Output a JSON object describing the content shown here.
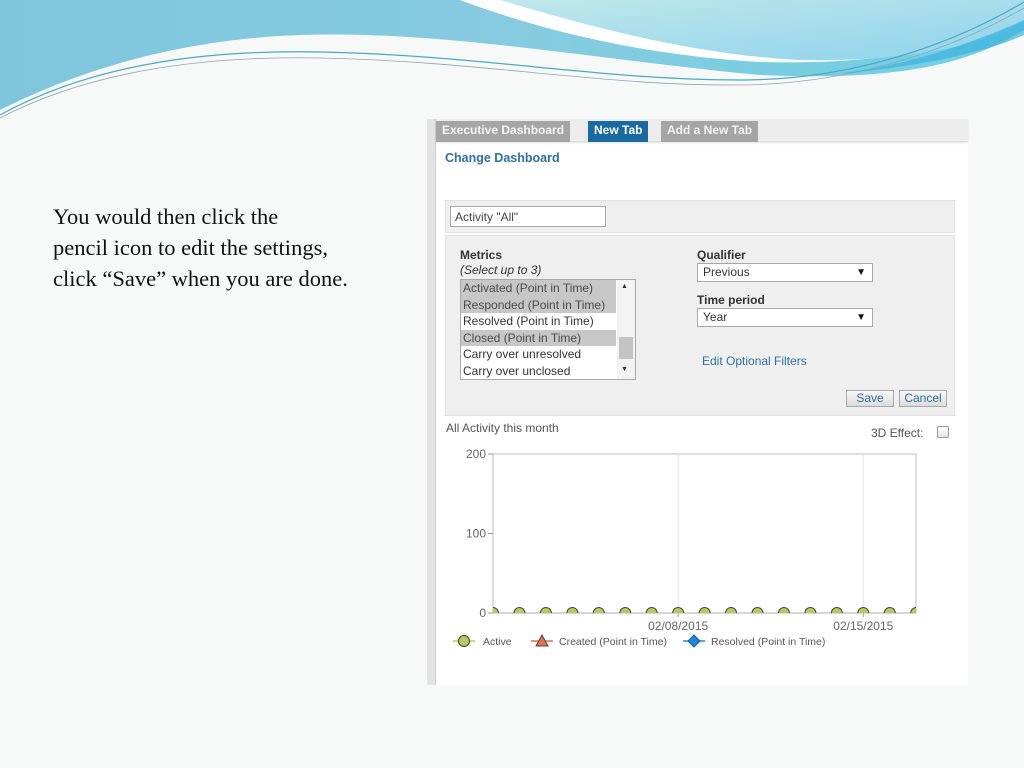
{
  "slide": {
    "lines": [
      "You would then click the",
      "pencil icon to edit the settings,",
      "click “Save” when you are done."
    ]
  },
  "tabs": [
    {
      "label": "Executive Dashboard",
      "active": false
    },
    {
      "label": "New Tab",
      "active": true
    },
    {
      "label": "Add a New Tab",
      "active": false
    }
  ],
  "change_dashboard_link": "Change Dashboard",
  "title_input": {
    "value": "Activity \"All\""
  },
  "metrics": {
    "label": "Metrics",
    "hint": "(Select up to 3)",
    "options": [
      {
        "label": "Activated (Point in Time)",
        "selected": true
      },
      {
        "label": "Responded (Point in Time)",
        "selected": true
      },
      {
        "label": "Resolved (Point in Time)",
        "selected": false
      },
      {
        "label": "Closed (Point in Time)",
        "selected": true
      },
      {
        "label": "Carry over unresolved",
        "selected": false
      },
      {
        "label": "Carry over unclosed",
        "selected": false
      }
    ],
    "scroll_up_icon": "▲",
    "scroll_down_icon": "▼"
  },
  "qualifier": {
    "label": "Qualifier",
    "value": "Previous",
    "caret": "▼"
  },
  "time_period": {
    "label": "Time period",
    "value": "Year",
    "caret": "▼"
  },
  "edit_filters_link": "Edit Optional Filters",
  "buttons": {
    "save": "Save",
    "cancel": "Cancel"
  },
  "chart_header": {
    "title": "All Activity this month",
    "effect_label": "3D Effect:",
    "effect_checked": false
  },
  "colors": {
    "active_tab": "#1a6aa1",
    "inactive_tab": "#a5a5a5",
    "link": "#2f6fa3",
    "active_series": "#b5cc5a",
    "created_series": "#e2714f",
    "resolved_series": "#1e88d8"
  },
  "chart_data": {
    "type": "line",
    "title": "All Activity this month",
    "xlabel": "",
    "ylabel": "",
    "ylim": [
      0,
      200
    ],
    "yticks": [
      0,
      100,
      200
    ],
    "x": [
      "02/01/2015",
      "02/02/2015",
      "02/03/2015",
      "02/04/2015",
      "02/05/2015",
      "02/06/2015",
      "02/07/2015",
      "02/08/2015",
      "02/09/2015",
      "02/10/2015",
      "02/11/2015",
      "02/12/2015",
      "02/13/2015",
      "02/14/2015",
      "02/15/2015",
      "02/16/2015",
      "02/17/2015"
    ],
    "xticks": [
      "02/08/2015",
      "02/15/2015"
    ],
    "grid": "vertical at x ticks",
    "legend_position": "bottom",
    "series": [
      {
        "name": "Active",
        "marker": "circle",
        "values": [
          0,
          0,
          0,
          0,
          0,
          0,
          0,
          0,
          0,
          0,
          0,
          0,
          0,
          0,
          0,
          0,
          0
        ]
      },
      {
        "name": "Created (Point in Time)",
        "marker": "triangle",
        "values": []
      },
      {
        "name": "Resolved (Point in Time)",
        "marker": "diamond",
        "values": []
      }
    ]
  }
}
